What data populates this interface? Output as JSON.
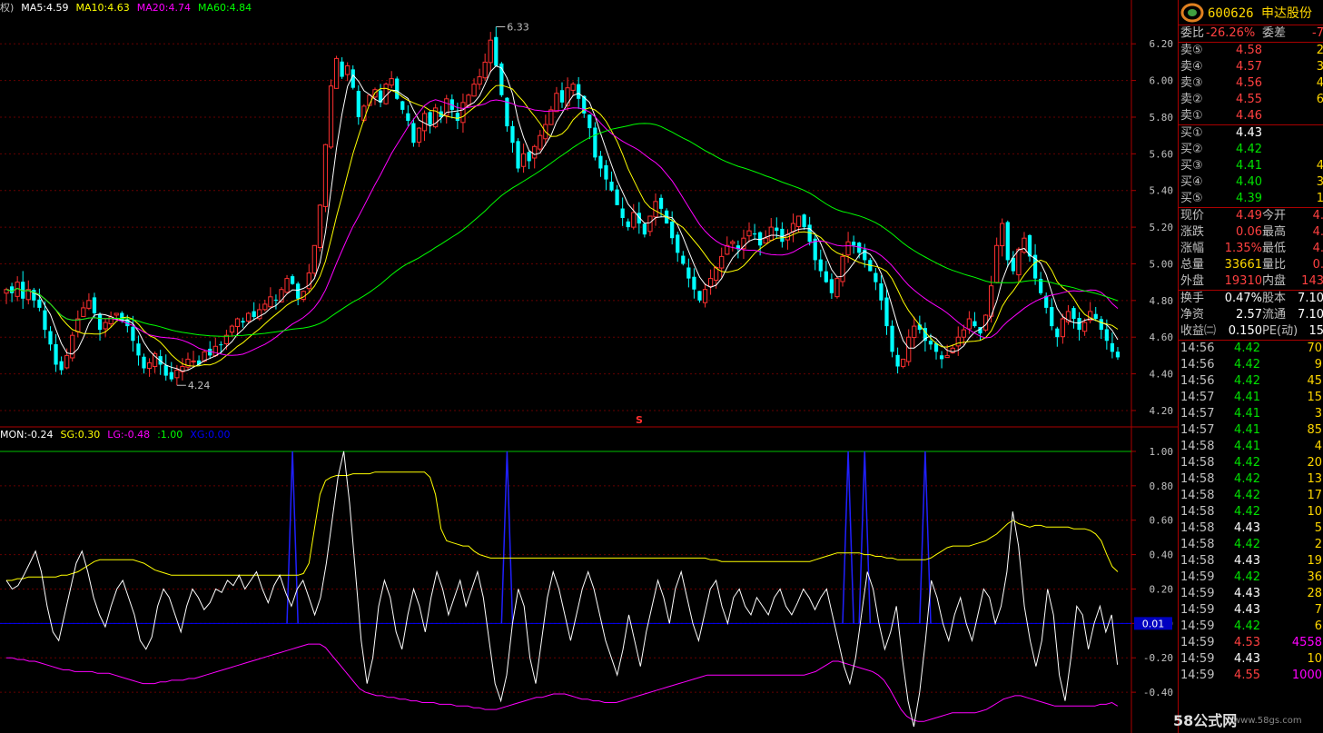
{
  "legend_main": [
    {
      "text": "权)",
      "color": "#c0c0c0"
    },
    {
      "text": "MA5:4.59",
      "color": "#ffffff"
    },
    {
      "text": "MA10:4.63",
      "color": "#ffff00"
    },
    {
      "text": "MA20:4.74",
      "color": "#ff00ff"
    },
    {
      "text": "MA60:4.84",
      "color": "#00ff00"
    }
  ],
  "legend_ind": [
    {
      "text": "MON:-0.24",
      "color": "#ffffff"
    },
    {
      "text": "SG:0.30",
      "color": "#ffff00"
    },
    {
      "text": "LG:-0.48",
      "color": "#ff00ff"
    },
    {
      "text": ":1.00",
      "color": "#00ff00"
    },
    {
      "text": "XG:0.00",
      "color": "#0000ff"
    }
  ],
  "price_axis_labels": [
    "6.20",
    "6.00",
    "5.80",
    "5.60",
    "5.40",
    "5.20",
    "5.00",
    "4.80",
    "4.60",
    "4.40",
    "4.20"
  ],
  "ind_axis_labels": [
    "1.00",
    "0.80",
    "0.60",
    "0.40",
    "0.20",
    "0.00",
    "-0.20",
    "-0.40"
  ],
  "ind_marker_label": "0.01",
  "annotations": {
    "high": "6.33",
    "low": "4.24",
    "s_marker": "S"
  },
  "panel": {
    "code": "600626",
    "name": "申达股份",
    "weibi_label": "委比",
    "weibi_value": "-26.26%",
    "weicha_label": "委差",
    "weicha_value": "-7",
    "asks": [
      {
        "label": "卖⑤",
        "price": "4.58",
        "vol": "2"
      },
      {
        "label": "卖④",
        "price": "4.57",
        "vol": "3"
      },
      {
        "label": "卖③",
        "price": "4.56",
        "vol": "4"
      },
      {
        "label": "卖②",
        "price": "4.55",
        "vol": "6"
      },
      {
        "label": "卖①",
        "price": "4.46",
        "vol": ""
      }
    ],
    "bids": [
      {
        "label": "买①",
        "price": "4.43",
        "vol": "",
        "cls": "white"
      },
      {
        "label": "买②",
        "price": "4.42",
        "vol": "",
        "cls": "green"
      },
      {
        "label": "买③",
        "price": "4.41",
        "vol": "4",
        "cls": "green"
      },
      {
        "label": "买④",
        "price": "4.40",
        "vol": "3",
        "cls": "green"
      },
      {
        "label": "买⑤",
        "price": "4.39",
        "vol": "1",
        "cls": "green"
      }
    ],
    "quote": [
      {
        "l1": "现价",
        "v1": "4.49",
        "c1": "red",
        "l2": "今开",
        "v2": "4."
      },
      {
        "l1": "涨跌",
        "v1": "0.06",
        "c1": "red",
        "l2": "最高",
        "v2": "4."
      },
      {
        "l1": "涨幅",
        "v1": "1.35%",
        "c1": "red",
        "l2": "最低",
        "v2": "4."
      },
      {
        "l1": "总量",
        "v1": "33661",
        "c1": "yellow",
        "l2": "量比",
        "v2": "0."
      },
      {
        "l1": "外盘",
        "v1": "19310",
        "c1": "red",
        "l2": "内盘",
        "v2": "143"
      }
    ],
    "info": [
      {
        "l1": "换手",
        "v1": "0.47%",
        "l2": "股本",
        "v2": "7.10"
      },
      {
        "l1": "净资",
        "v1": "2.57",
        "l2": "流通",
        "v2": "7.10"
      },
      {
        "l1": "收益㈡",
        "v1": "0.150",
        "l2": "PE(动)",
        "v2": "15"
      }
    ],
    "ticks": [
      {
        "t": "14:56",
        "p": "4.42",
        "pc": "green",
        "q": "70",
        "qc": "yellow"
      },
      {
        "t": "14:56",
        "p": "4.42",
        "pc": "green",
        "q": "9",
        "qc": "yellow"
      },
      {
        "t": "14:56",
        "p": "4.42",
        "pc": "green",
        "q": "45",
        "qc": "yellow"
      },
      {
        "t": "14:57",
        "p": "4.41",
        "pc": "green",
        "q": "15",
        "qc": "yellow"
      },
      {
        "t": "14:57",
        "p": "4.41",
        "pc": "green",
        "q": "3",
        "qc": "yellow"
      },
      {
        "t": "14:57",
        "p": "4.41",
        "pc": "green",
        "q": "85",
        "qc": "yellow"
      },
      {
        "t": "14:58",
        "p": "4.41",
        "pc": "green",
        "q": "4",
        "qc": "yellow"
      },
      {
        "t": "14:58",
        "p": "4.42",
        "pc": "green",
        "q": "20",
        "qc": "yellow"
      },
      {
        "t": "14:58",
        "p": "4.42",
        "pc": "green",
        "q": "13",
        "qc": "yellow"
      },
      {
        "t": "14:58",
        "p": "4.42",
        "pc": "green",
        "q": "17",
        "qc": "yellow"
      },
      {
        "t": "14:58",
        "p": "4.42",
        "pc": "green",
        "q": "10",
        "qc": "yellow"
      },
      {
        "t": "14:58",
        "p": "4.43",
        "pc": "white",
        "q": "5",
        "qc": "yellow"
      },
      {
        "t": "14:58",
        "p": "4.42",
        "pc": "green",
        "q": "2",
        "qc": "yellow"
      },
      {
        "t": "14:58",
        "p": "4.43",
        "pc": "white",
        "q": "19",
        "qc": "yellow"
      },
      {
        "t": "14:59",
        "p": "4.42",
        "pc": "green",
        "q": "36",
        "qc": "yellow"
      },
      {
        "t": "14:59",
        "p": "4.43",
        "pc": "white",
        "q": "28",
        "qc": "yellow"
      },
      {
        "t": "14:59",
        "p": "4.43",
        "pc": "white",
        "q": "7",
        "qc": "yellow"
      },
      {
        "t": "14:59",
        "p": "4.42",
        "pc": "green",
        "q": "6",
        "qc": "yellow"
      },
      {
        "t": "14:59",
        "p": "4.53",
        "pc": "red",
        "q": "4558",
        "qc": "magenta"
      },
      {
        "t": "14:59",
        "p": "4.43",
        "pc": "white",
        "q": "10",
        "qc": "yellow"
      },
      {
        "t": "14:59",
        "p": "4.55",
        "pc": "red",
        "q": "1000",
        "qc": "magenta"
      }
    ]
  },
  "watermark": "www.58gs.com",
  "watermark_brand": "58公式网",
  "chart_data": {
    "type": "candlestick",
    "price_range": [
      4.17,
      6.33
    ],
    "indicator_range": [
      -0.6,
      1.1
    ],
    "close": [
      4.86,
      4.84,
      4.9,
      4.81,
      4.86,
      4.8,
      4.76,
      4.64,
      4.56,
      4.45,
      4.42,
      4.5,
      4.61,
      4.7,
      4.76,
      4.8,
      4.73,
      4.64,
      4.68,
      4.71,
      4.73,
      4.69,
      4.66,
      4.58,
      4.5,
      4.43,
      4.46,
      4.51,
      4.45,
      4.39,
      4.37,
      4.42,
      4.44,
      4.48,
      4.47,
      4.45,
      4.52,
      4.5,
      4.55,
      4.56,
      4.61,
      4.66,
      4.7,
      4.68,
      4.73,
      4.71,
      4.75,
      4.78,
      4.82,
      4.8,
      4.86,
      4.92,
      4.89,
      4.81,
      4.85,
      4.95,
      5.1,
      5.32,
      5.65,
      5.97,
      6.12,
      6.02,
      6.08,
      5.96,
      5.8,
      5.86,
      5.92,
      5.95,
      5.88,
      5.98,
      6.01,
      5.9,
      5.84,
      5.78,
      5.66,
      5.74,
      5.82,
      5.76,
      5.85,
      5.8,
      5.9,
      5.84,
      5.78,
      5.88,
      5.92,
      5.98,
      6.02,
      6.1,
      6.22,
      6.08,
      5.92,
      5.75,
      5.66,
      5.52,
      5.6,
      5.56,
      5.64,
      5.7,
      5.76,
      5.84,
      5.93,
      5.88,
      5.96,
      5.98,
      5.9,
      5.82,
      5.74,
      5.58,
      5.52,
      5.46,
      5.4,
      5.32,
      5.25,
      5.2,
      5.28,
      5.22,
      5.16,
      5.26,
      5.34,
      5.3,
      5.22,
      5.14,
      5.06,
      5.0,
      4.92,
      4.86,
      4.8,
      4.86,
      4.92,
      4.98,
      5.04,
      5.1,
      5.12,
      5.08,
      5.14,
      5.18,
      5.16,
      5.1,
      5.14,
      5.2,
      5.18,
      5.12,
      5.16,
      5.22,
      5.26,
      5.2,
      5.12,
      5.02,
      4.96,
      4.9,
      4.84,
      4.92,
      5.04,
      5.12,
      5.1,
      5.06,
      5.02,
      4.96,
      4.9,
      4.8,
      4.66,
      4.52,
      4.44,
      4.48,
      4.6,
      4.66,
      4.64,
      4.58,
      4.56,
      4.52,
      4.48,
      4.5,
      4.54,
      4.6,
      4.64,
      4.7,
      4.66,
      4.62,
      4.72,
      4.88,
      5.1,
      5.22,
      5.02,
      4.96,
      5.08,
      5.14,
      5.04,
      4.92,
      4.84,
      4.76,
      4.66,
      4.6,
      4.7,
      4.74,
      4.7,
      4.64,
      4.68,
      4.74,
      4.7,
      4.64,
      4.58,
      4.52,
      4.49
    ],
    "ma_windows": [
      5,
      10,
      20,
      60
    ],
    "ma_colors": [
      "#ffffff",
      "#ffff00",
      "#ff00ff",
      "#00ff00"
    ],
    "mon": [
      0.25,
      0.2,
      0.22,
      0.28,
      0.35,
      0.42,
      0.3,
      0.1,
      -0.05,
      -0.1,
      0.05,
      0.2,
      0.35,
      0.42,
      0.3,
      0.15,
      0.05,
      -0.02,
      0.1,
      0.2,
      0.25,
      0.15,
      0.05,
      -0.1,
      -0.15,
      -0.08,
      0.1,
      0.2,
      0.15,
      0.05,
      -0.05,
      0.1,
      0.2,
      0.15,
      0.08,
      0.12,
      0.2,
      0.18,
      0.25,
      0.22,
      0.28,
      0.2,
      0.25,
      0.3,
      0.2,
      0.12,
      0.22,
      0.28,
      0.18,
      0.1,
      0.2,
      0.25,
      0.15,
      0.05,
      0.15,
      0.35,
      0.6,
      0.85,
      1.0,
      0.7,
      0.3,
      -0.1,
      -0.35,
      -0.2,
      0.1,
      0.25,
      0.15,
      -0.05,
      -0.15,
      0.05,
      0.2,
      0.1,
      -0.05,
      0.15,
      0.3,
      0.2,
      0.05,
      0.15,
      0.25,
      0.1,
      0.2,
      0.3,
      0.15,
      -0.1,
      -0.35,
      -0.45,
      -0.3,
      0.0,
      0.2,
      0.1,
      -0.2,
      -0.35,
      -0.1,
      0.15,
      0.3,
      0.2,
      0.05,
      -0.1,
      0.05,
      0.2,
      0.3,
      0.2,
      0.05,
      -0.1,
      -0.2,
      -0.3,
      -0.15,
      0.05,
      -0.1,
      -0.25,
      -0.05,
      0.1,
      0.25,
      0.15,
      0.0,
      0.2,
      0.3,
      0.15,
      0.0,
      -0.1,
      0.05,
      0.2,
      0.25,
      0.1,
      0.0,
      0.15,
      0.2,
      0.1,
      0.05,
      0.15,
      0.1,
      0.05,
      0.15,
      0.2,
      0.1,
      0.05,
      0.12,
      0.2,
      0.15,
      0.08,
      0.15,
      0.2,
      0.05,
      -0.1,
      -0.25,
      -0.35,
      -0.2,
      0.05,
      0.3,
      0.2,
      0.0,
      -0.15,
      -0.05,
      0.1,
      -0.2,
      -0.45,
      -0.6,
      -0.4,
      -0.1,
      0.25,
      0.15,
      0.0,
      -0.1,
      0.05,
      0.15,
      0.0,
      -0.1,
      0.05,
      0.2,
      0.15,
      0.0,
      0.1,
      0.3,
      0.65,
      0.45,
      0.1,
      -0.1,
      -0.25,
      -0.1,
      0.2,
      0.05,
      -0.3,
      -0.45,
      -0.2,
      0.1,
      0.05,
      -0.15,
      0.0,
      0.1,
      -0.05,
      0.05,
      -0.24
    ],
    "sg": [
      0.25,
      0.25,
      0.26,
      0.26,
      0.27,
      0.27,
      0.27,
      0.27,
      0.27,
      0.27,
      0.28,
      0.28,
      0.29,
      0.3,
      0.32,
      0.34,
      0.36,
      0.37,
      0.37,
      0.37,
      0.37,
      0.37,
      0.37,
      0.37,
      0.36,
      0.35,
      0.33,
      0.31,
      0.3,
      0.29,
      0.28,
      0.28,
      0.28,
      0.28,
      0.28,
      0.28,
      0.28,
      0.28,
      0.28,
      0.28,
      0.28,
      0.28,
      0.28,
      0.28,
      0.28,
      0.28,
      0.28,
      0.28,
      0.28,
      0.28,
      0.28,
      0.28,
      0.28,
      0.28,
      0.29,
      0.35,
      0.55,
      0.75,
      0.83,
      0.85,
      0.86,
      0.86,
      0.86,
      0.87,
      0.87,
      0.87,
      0.87,
      0.88,
      0.88,
      0.88,
      0.88,
      0.88,
      0.88,
      0.88,
      0.88,
      0.88,
      0.88,
      0.85,
      0.75,
      0.55,
      0.48,
      0.47,
      0.46,
      0.45,
      0.45,
      0.42,
      0.4,
      0.39,
      0.38,
      0.38,
      0.38,
      0.38,
      0.38,
      0.38,
      0.38,
      0.38,
      0.38,
      0.38,
      0.38,
      0.38,
      0.38,
      0.38,
      0.38,
      0.38,
      0.38,
      0.38,
      0.38,
      0.38,
      0.38,
      0.38,
      0.38,
      0.38,
      0.38,
      0.38,
      0.38,
      0.38,
      0.38,
      0.38,
      0.38,
      0.38,
      0.38,
      0.38,
      0.38,
      0.38,
      0.38,
      0.38,
      0.38,
      0.38,
      0.37,
      0.37,
      0.36,
      0.36,
      0.36,
      0.36,
      0.36,
      0.36,
      0.36,
      0.36,
      0.36,
      0.36,
      0.36,
      0.36,
      0.36,
      0.36,
      0.36,
      0.36,
      0.36,
      0.37,
      0.38,
      0.39,
      0.4,
      0.41,
      0.41,
      0.41,
      0.41,
      0.41,
      0.4,
      0.4,
      0.39,
      0.39,
      0.38,
      0.38,
      0.37,
      0.37,
      0.37,
      0.37,
      0.37,
      0.37,
      0.38,
      0.4,
      0.42,
      0.44,
      0.45,
      0.45,
      0.45,
      0.45,
      0.46,
      0.47,
      0.48,
      0.5,
      0.52,
      0.55,
      0.58,
      0.6,
      0.58,
      0.57,
      0.56,
      0.57,
      0.57,
      0.56,
      0.56,
      0.56,
      0.56,
      0.56,
      0.55,
      0.55,
      0.55,
      0.54,
      0.52,
      0.48,
      0.4,
      0.33,
      0.3
    ],
    "lg": [
      -0.2,
      -0.2,
      -0.21,
      -0.21,
      -0.22,
      -0.22,
      -0.23,
      -0.24,
      -0.25,
      -0.26,
      -0.27,
      -0.27,
      -0.28,
      -0.28,
      -0.28,
      -0.28,
      -0.29,
      -0.29,
      -0.29,
      -0.3,
      -0.31,
      -0.32,
      -0.33,
      -0.34,
      -0.35,
      -0.35,
      -0.35,
      -0.34,
      -0.34,
      -0.33,
      -0.33,
      -0.33,
      -0.32,
      -0.32,
      -0.31,
      -0.3,
      -0.29,
      -0.28,
      -0.27,
      -0.26,
      -0.25,
      -0.24,
      -0.23,
      -0.22,
      -0.21,
      -0.2,
      -0.19,
      -0.18,
      -0.17,
      -0.16,
      -0.15,
      -0.14,
      -0.13,
      -0.12,
      -0.12,
      -0.12,
      -0.14,
      -0.18,
      -0.22,
      -0.26,
      -0.3,
      -0.34,
      -0.38,
      -0.4,
      -0.41,
      -0.42,
      -0.42,
      -0.43,
      -0.43,
      -0.44,
      -0.44,
      -0.45,
      -0.45,
      -0.46,
      -0.46,
      -0.46,
      -0.47,
      -0.47,
      -0.47,
      -0.48,
      -0.48,
      -0.48,
      -0.49,
      -0.49,
      -0.5,
      -0.5,
      -0.5,
      -0.49,
      -0.48,
      -0.47,
      -0.46,
      -0.45,
      -0.44,
      -0.43,
      -0.43,
      -0.42,
      -0.41,
      -0.41,
      -0.41,
      -0.42,
      -0.43,
      -0.44,
      -0.44,
      -0.45,
      -0.45,
      -0.46,
      -0.46,
      -0.46,
      -0.45,
      -0.44,
      -0.43,
      -0.42,
      -0.41,
      -0.4,
      -0.39,
      -0.38,
      -0.37,
      -0.36,
      -0.35,
      -0.34,
      -0.33,
      -0.32,
      -0.31,
      -0.3,
      -0.3,
      -0.3,
      -0.3,
      -0.3,
      -0.3,
      -0.3,
      -0.3,
      -0.3,
      -0.3,
      -0.3,
      -0.3,
      -0.3,
      -0.3,
      -0.3,
      -0.3,
      -0.3,
      -0.3,
      -0.29,
      -0.28,
      -0.26,
      -0.24,
      -0.22,
      -0.22,
      -0.23,
      -0.24,
      -0.25,
      -0.26,
      -0.27,
      -0.28,
      -0.3,
      -0.33,
      -0.38,
      -0.44,
      -0.5,
      -0.54,
      -0.56,
      -0.57,
      -0.57,
      -0.56,
      -0.55,
      -0.54,
      -0.53,
      -0.52,
      -0.52,
      -0.52,
      -0.52,
      -0.52,
      -0.51,
      -0.5,
      -0.48,
      -0.46,
      -0.44,
      -0.43,
      -0.42,
      -0.42,
      -0.43,
      -0.44,
      -0.45,
      -0.46,
      -0.47,
      -0.48,
      -0.48,
      -0.48,
      -0.48,
      -0.48,
      -0.48,
      -0.48,
      -0.48,
      -0.47,
      -0.47,
      -0.46,
      -0.48
    ],
    "xg_spikes": [
      52,
      91,
      153,
      156,
      167
    ],
    "ref_line_top": 1.0,
    "ref_line_mid": 0.0
  }
}
